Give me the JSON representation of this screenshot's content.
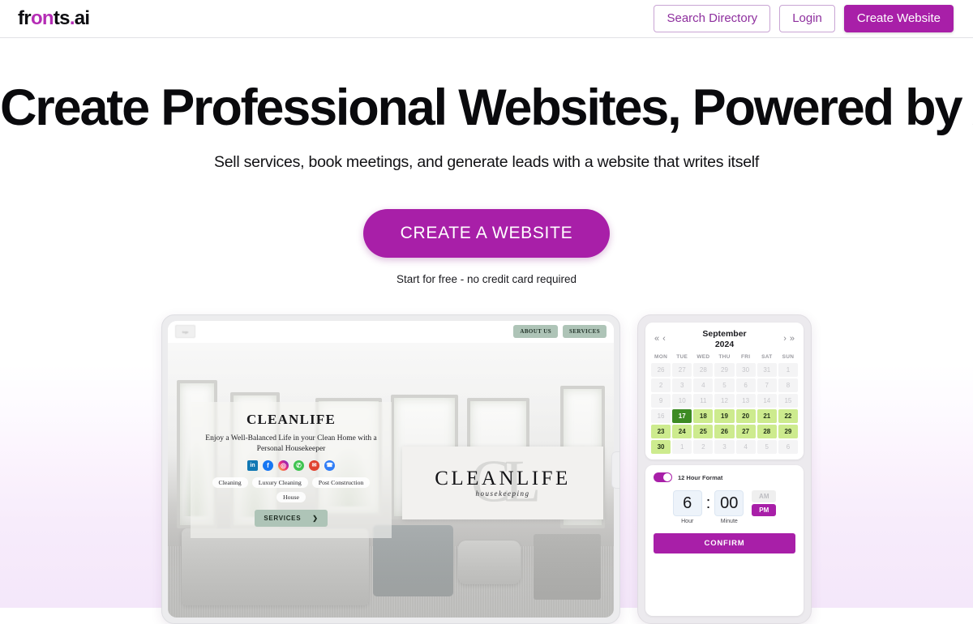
{
  "header": {
    "logo": {
      "pre": "fr",
      "accent": "on",
      "post": "ts",
      "dot": ".",
      "tail": "ai"
    },
    "search_directory": "Search Directory",
    "login": "Login",
    "create_website": "Create Website"
  },
  "hero": {
    "headline": "Create Professional Websites, Powered by AI",
    "subheadline": "Sell services, book meetings, and generate leads with a website that writes itself",
    "cta_label": "CREATE A WEBSITE",
    "cta_note": "Start for free - no credit card required"
  },
  "preview": {
    "nav": {
      "about": "ABOUT US",
      "services": "SERVICES",
      "logo_placeholder": "logo"
    },
    "hero": {
      "title": "CLEANLIFE",
      "tagline": "Enjoy a Well-Balanced Life in your Clean Home with a Personal Housekeeper",
      "tags": [
        "Cleaning",
        "Luxury Cleaning",
        "Post Construction",
        "House"
      ],
      "cta_label": "SERVICES",
      "cta_arrow": "❯",
      "social": [
        {
          "name": "linkedin",
          "glyph": "in"
        },
        {
          "name": "facebook",
          "glyph": "f"
        },
        {
          "name": "instagram",
          "glyph": "◎"
        },
        {
          "name": "whatsapp",
          "glyph": "✆"
        },
        {
          "name": "email",
          "glyph": "✉"
        },
        {
          "name": "phone",
          "glyph": "☎"
        }
      ]
    },
    "logo_card": {
      "watermark": "CL",
      "name": "CLEANLIFE",
      "subtitle": "housekeeping"
    }
  },
  "booking": {
    "calendar": {
      "month": "September",
      "year": "2024",
      "nav": {
        "first": "«",
        "prev": "‹",
        "next": "›",
        "last": "»"
      },
      "weekdays": [
        "MON",
        "TUE",
        "WED",
        "THU",
        "FRI",
        "SAT",
        "SUN"
      ],
      "days": [
        {
          "n": "26",
          "s": "muted"
        },
        {
          "n": "27",
          "s": "muted"
        },
        {
          "n": "28",
          "s": "muted"
        },
        {
          "n": "29",
          "s": "muted"
        },
        {
          "n": "30",
          "s": "muted"
        },
        {
          "n": "31",
          "s": "muted"
        },
        {
          "n": "1",
          "s": "muted"
        },
        {
          "n": "2",
          "s": "muted"
        },
        {
          "n": "3",
          "s": "muted"
        },
        {
          "n": "4",
          "s": "muted"
        },
        {
          "n": "5",
          "s": "muted"
        },
        {
          "n": "6",
          "s": "muted"
        },
        {
          "n": "7",
          "s": "muted"
        },
        {
          "n": "8",
          "s": "muted"
        },
        {
          "n": "9",
          "s": "muted"
        },
        {
          "n": "10",
          "s": "muted"
        },
        {
          "n": "11",
          "s": "muted"
        },
        {
          "n": "12",
          "s": "muted"
        },
        {
          "n": "13",
          "s": "muted"
        },
        {
          "n": "14",
          "s": "muted"
        },
        {
          "n": "15",
          "s": "muted"
        },
        {
          "n": "16",
          "s": "muted"
        },
        {
          "n": "17",
          "s": "selected"
        },
        {
          "n": "18",
          "s": "avail"
        },
        {
          "n": "19",
          "s": "avail"
        },
        {
          "n": "20",
          "s": "avail"
        },
        {
          "n": "21",
          "s": "avail"
        },
        {
          "n": "22",
          "s": "avail"
        },
        {
          "n": "23",
          "s": "avail"
        },
        {
          "n": "24",
          "s": "avail"
        },
        {
          "n": "25",
          "s": "avail"
        },
        {
          "n": "26",
          "s": "avail"
        },
        {
          "n": "27",
          "s": "avail"
        },
        {
          "n": "28",
          "s": "avail"
        },
        {
          "n": "29",
          "s": "avail"
        },
        {
          "n": "30",
          "s": "avail"
        },
        {
          "n": "1",
          "s": "muted"
        },
        {
          "n": "2",
          "s": "muted"
        },
        {
          "n": "3",
          "s": "muted"
        },
        {
          "n": "4",
          "s": "muted"
        },
        {
          "n": "5",
          "s": "muted"
        },
        {
          "n": "6",
          "s": "muted"
        }
      ]
    },
    "time": {
      "format_label": "12 Hour Format",
      "format_on": true,
      "hour": "6",
      "minute": "00",
      "colon": ":",
      "hour_label": "Hour",
      "minute_label": "Minute",
      "am_label": "AM",
      "pm_label": "PM",
      "meridiem_selected": "PM",
      "confirm_label": "CONFIRM"
    }
  },
  "colors": {
    "brand_purple": "#a81fa8",
    "brand_purple_text": "#8e2f9e",
    "sage": "#aec4b7",
    "calendar_selected": "#3d8b23",
    "calendar_available": "#cdeb8e"
  }
}
